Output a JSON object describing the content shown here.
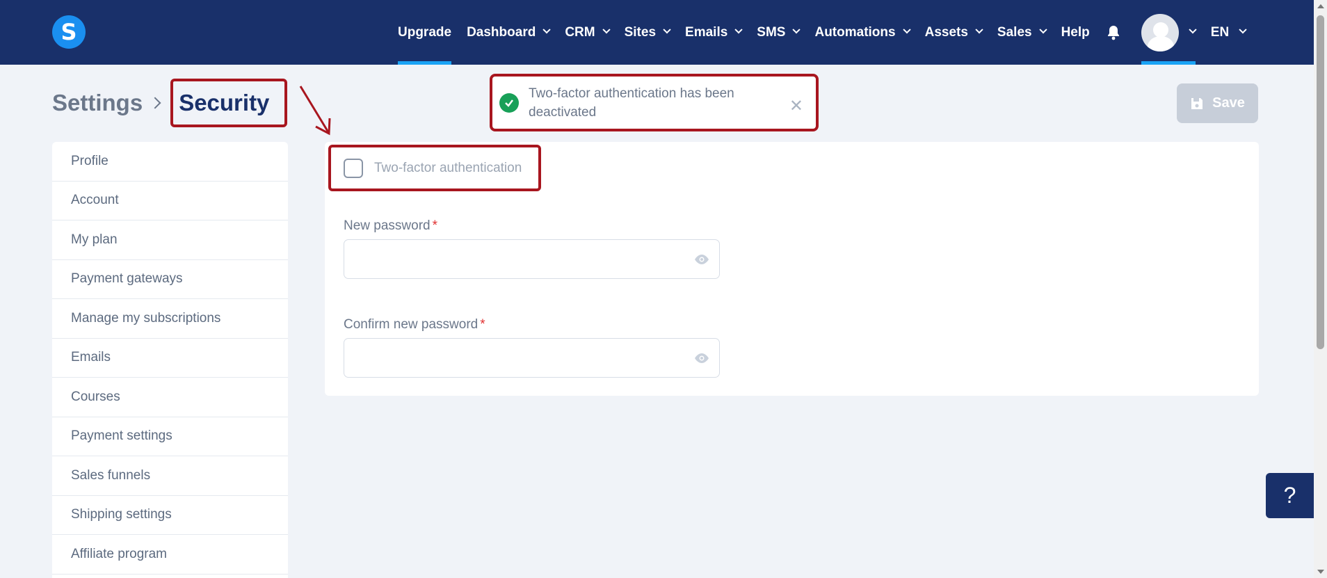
{
  "brand": {
    "logo_letter": "S",
    "accent": "#1aa3f5",
    "nav_bg": "#19306a"
  },
  "nav": {
    "items": [
      {
        "label": "Upgrade",
        "dropdown": false,
        "active": true
      },
      {
        "label": "Dashboard",
        "dropdown": true
      },
      {
        "label": "CRM",
        "dropdown": true
      },
      {
        "label": "Sites",
        "dropdown": true
      },
      {
        "label": "Emails",
        "dropdown": true
      },
      {
        "label": "SMS",
        "dropdown": true
      },
      {
        "label": "Automations",
        "dropdown": true
      },
      {
        "label": "Assets",
        "dropdown": true
      },
      {
        "label": "Sales",
        "dropdown": true
      },
      {
        "label": "Help",
        "dropdown": false
      }
    ],
    "language": "EN"
  },
  "breadcrumb": {
    "parent": "Settings",
    "current": "Security"
  },
  "toast": {
    "message": "Two-factor authentication has been deactivated",
    "status_color": "#18a058"
  },
  "toolbar": {
    "save_label": "Save"
  },
  "sidebar": {
    "items": [
      {
        "label": "Profile"
      },
      {
        "label": "Account"
      },
      {
        "label": "My plan"
      },
      {
        "label": "Payment gateways"
      },
      {
        "label": "Manage my subscriptions"
      },
      {
        "label": "Emails"
      },
      {
        "label": "Courses"
      },
      {
        "label": "Payment settings"
      },
      {
        "label": "Sales funnels"
      },
      {
        "label": "Shipping settings"
      },
      {
        "label": "Affiliate program"
      }
    ]
  },
  "form": {
    "two_factor_label": "Two-factor authentication",
    "two_factor_checked": false,
    "new_password_label": "New password",
    "new_password_value": "",
    "confirm_password_label": "Confirm new password",
    "confirm_password_value": "",
    "required_mark": "*"
  },
  "help_widget": {
    "label": "?"
  }
}
